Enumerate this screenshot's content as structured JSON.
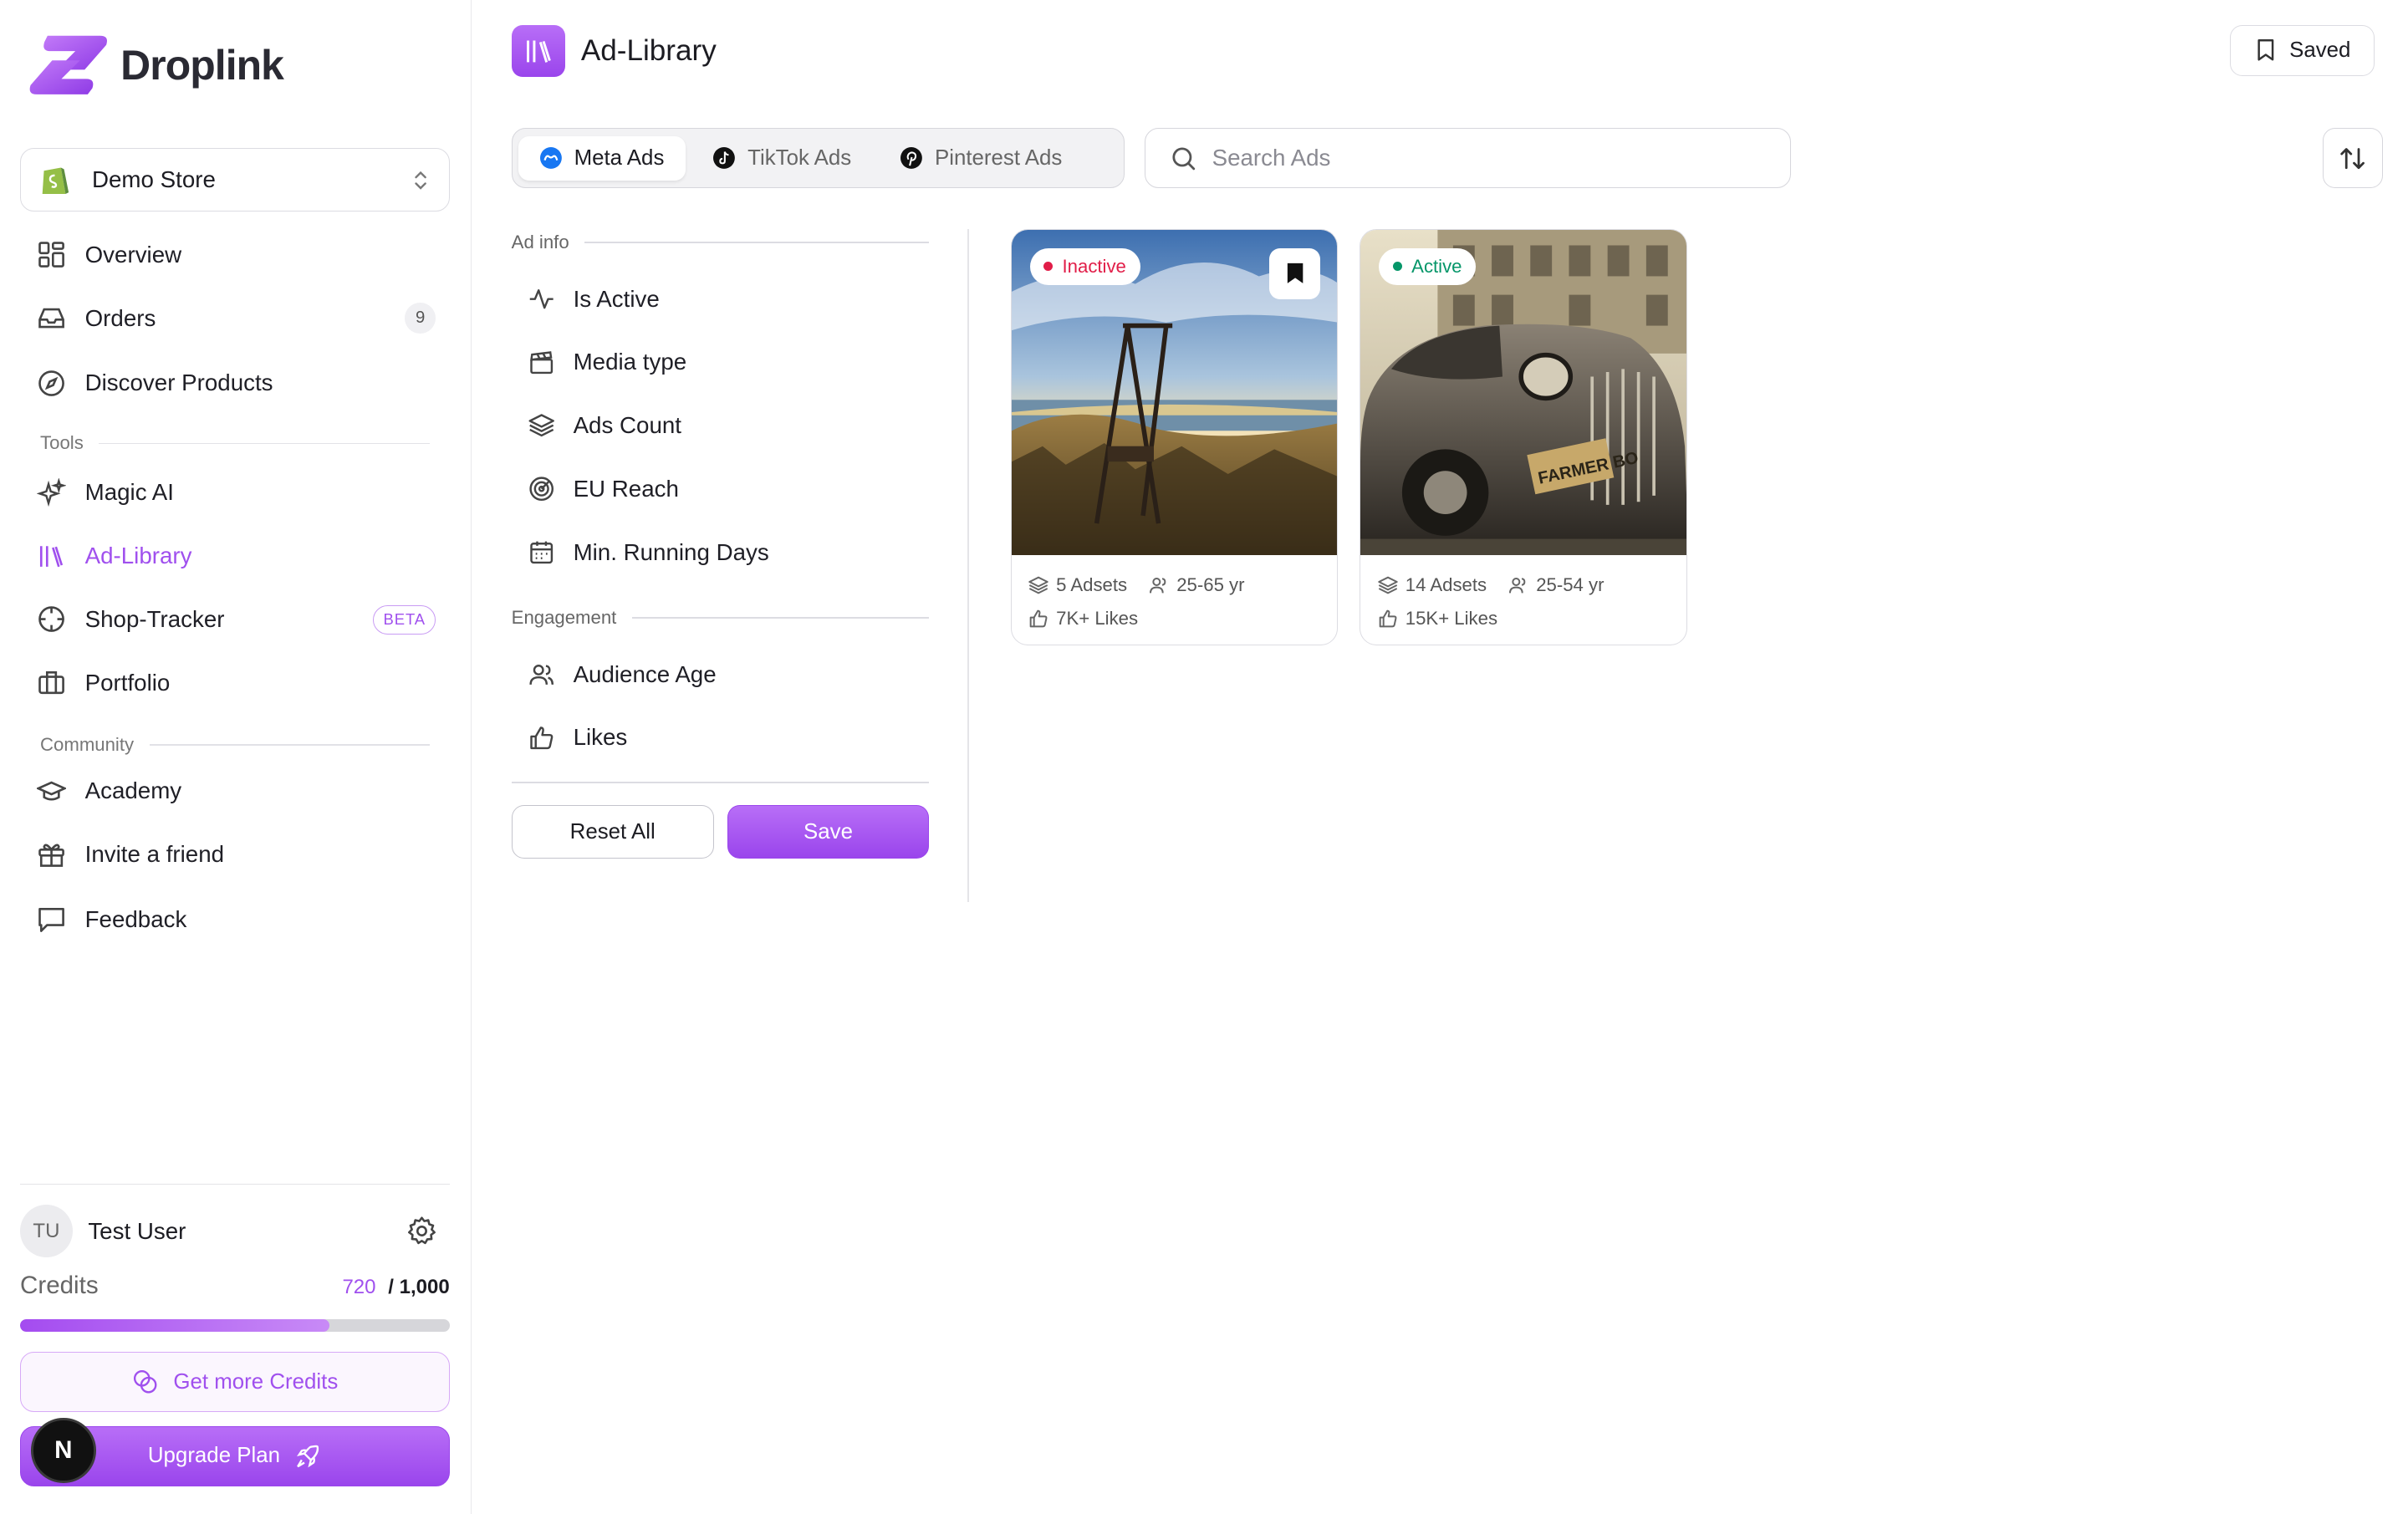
{
  "brand": {
    "name": "Droplink"
  },
  "store": {
    "name": "Demo Store"
  },
  "nav": {
    "overview": "Overview",
    "orders": "Orders",
    "orders_count": "9",
    "discover": "Discover Products",
    "tools_label": "Tools",
    "magic_ai": "Magic AI",
    "ad_library": "Ad-Library",
    "shop_tracker": "Shop-Tracker",
    "beta": "BETA",
    "portfolio": "Portfolio",
    "community_label": "Community",
    "academy": "Academy",
    "invite": "Invite a friend",
    "feedback": "Feedback"
  },
  "user": {
    "initials": "TU",
    "name": "Test User"
  },
  "credits": {
    "label": "Credits",
    "used": "720",
    "total": "/ 1,000",
    "progress": 0.72
  },
  "buttons": {
    "get_credits": "Get more Credits",
    "upgrade": "Upgrade Plan",
    "n_badge": "N"
  },
  "header": {
    "title": "Ad-Library",
    "saved": "Saved"
  },
  "tabs": {
    "meta": "Meta Ads",
    "tiktok": "TikTok Ads",
    "pinterest": "Pinterest Ads"
  },
  "search": {
    "placeholder": "Search Ads"
  },
  "filters": {
    "ad_info_label": "Ad info",
    "is_active": "Is Active",
    "media_type": "Media type",
    "ads_count": "Ads Count",
    "eu_reach": "EU Reach",
    "min_running_days": "Min. Running Days",
    "engagement_label": "Engagement",
    "audience_age": "Audience Age",
    "likes": "Likes",
    "reset": "Reset All",
    "save": "Save"
  },
  "ads": [
    {
      "status": "Inactive",
      "status_color": "#e11d48",
      "adsets": "5 Adsets",
      "age": "25-65 yr",
      "likes": "7K+ Likes"
    },
    {
      "status": "Active",
      "status_color": "#059669",
      "adsets": "14 Adsets",
      "age": "25-54 yr",
      "likes": "15K+ Likes"
    }
  ],
  "colors": {
    "accent": "#a050ee"
  }
}
